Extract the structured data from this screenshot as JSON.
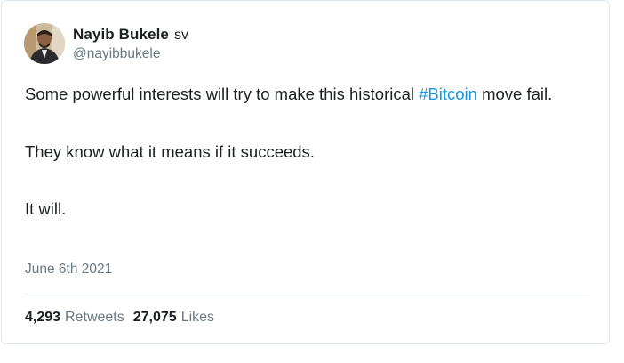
{
  "author": {
    "display_name": "Nayib Bukele",
    "country_flag": "sv",
    "handle": "@nayibbukele"
  },
  "tweet": {
    "line1_before": "Some powerful interests will try to make this historical ",
    "hashtag": "#Bitcoin",
    "line1_after": " move fail.",
    "paragraph2": "They know what it means if it succeeds.",
    "paragraph3": "It will.",
    "date": "June 6th 2021"
  },
  "stats": {
    "retweets_count": "4,293",
    "retweets_label": "Retweets",
    "likes_count": "27,075",
    "likes_label": "Likes"
  },
  "colors": {
    "link": "#1b95e0",
    "muted": "#697882",
    "text": "#1c2022",
    "border": "#e1e8ed"
  },
  "icons": {
    "avatar": "profile-photo"
  }
}
